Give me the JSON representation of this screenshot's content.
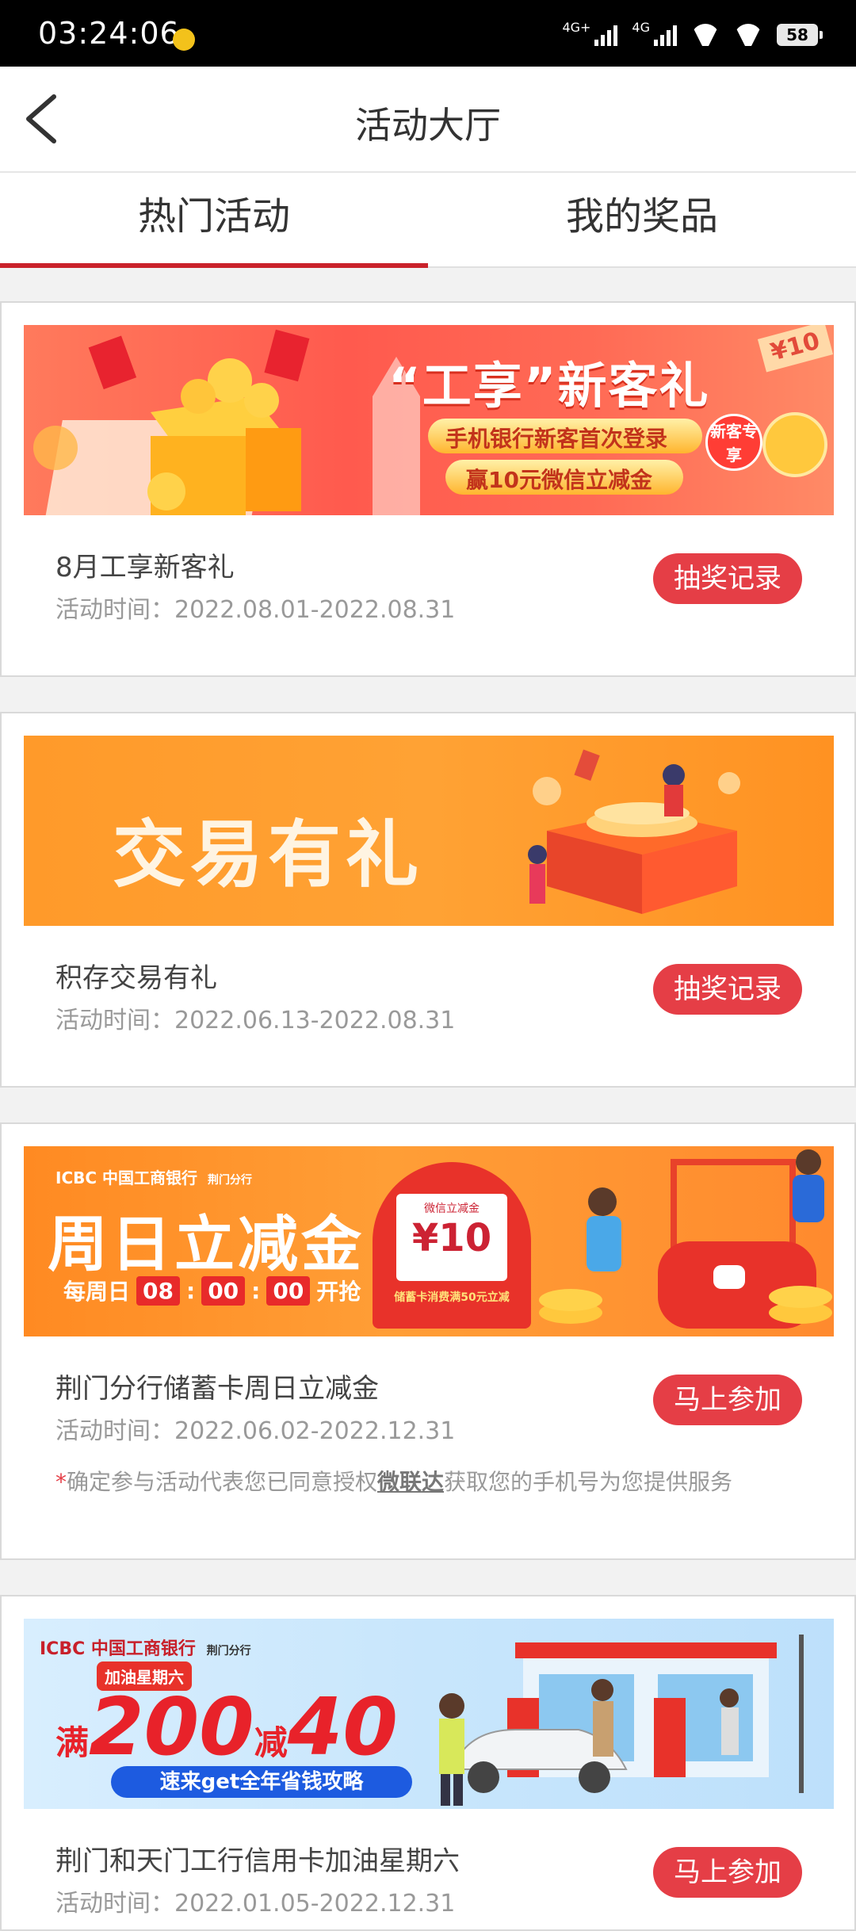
{
  "status_bar": {
    "time": "03:24:06",
    "network_1": "4G+",
    "network_2": "4G",
    "battery": "58"
  },
  "header": {
    "title": "活动大厅"
  },
  "tabs": [
    {
      "label": "热门活动",
      "active": true
    },
    {
      "label": "我的奖品",
      "active": false
    }
  ],
  "activities": [
    {
      "banner": {
        "title": "“工享”新客礼",
        "line1": "手机银行新客首次登录",
        "line2": "赢10元微信立减金",
        "badge": "新客专享",
        "corner": "¥10"
      },
      "name": "8月工享新客礼",
      "time": "活动时间：2022.08.01-2022.08.31",
      "button": "抽奖记录"
    },
    {
      "banner": {
        "title": "交易有礼"
      },
      "name": "积存交易有礼",
      "time": "活动时间：2022.06.13-2022.08.31",
      "button": "抽奖记录"
    },
    {
      "banner": {
        "brand": "ICBC 中国工商银行",
        "branch": "荆门分行",
        "title": "周日立减金",
        "sub": "每周日",
        "h": "08",
        "m": "00",
        "s": "00",
        "sub2": "开抢",
        "coupon_head": "微信立减金",
        "coupon_value": "¥10",
        "coupon_foot": "储蓄卡消费满50元立减"
      },
      "name": "荆门分行储蓄卡周日立减金",
      "time": "活动时间：2022.06.02-2022.12.31",
      "note_prefix": "*",
      "note_a": "确定参与活动代表您已同意授权",
      "note_link": "微联达",
      "note_b": "获取您的手机号为您提供服务",
      "button": "马上参加"
    },
    {
      "banner": {
        "brand": "ICBC 中国工商银行",
        "branch": "荆门分行",
        "tag": "加油星期六",
        "m1": "满",
        "v1": "200",
        "m2": "减",
        "v2": "40",
        "sub": "速来get全年省钱攻略"
      },
      "name": "荆门和天门工行信用卡加油星期六",
      "time": "活动时间：2022.01.05-2022.12.31",
      "button": "马上参加"
    }
  ],
  "colors": {
    "accent": "#c9222b",
    "button": "#e53e46"
  }
}
